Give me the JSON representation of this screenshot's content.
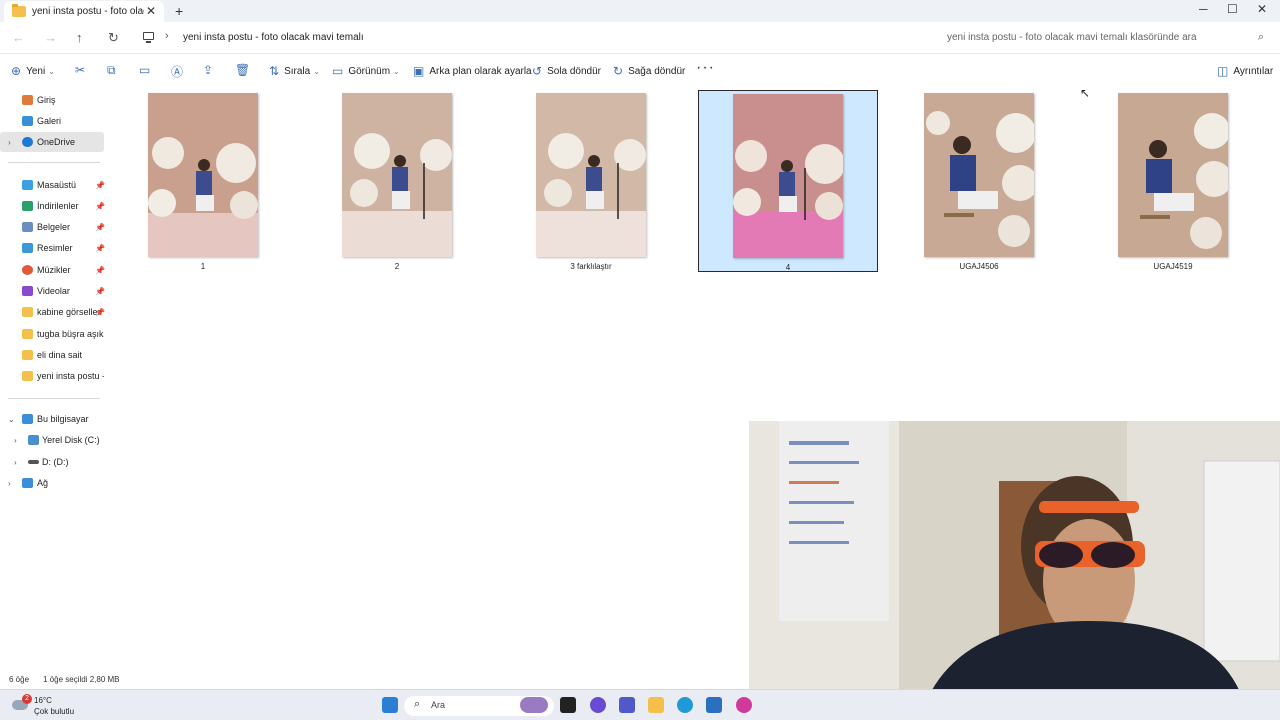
{
  "tab": {
    "title": "yeni insta postu -  foto olacak",
    "close": "✕",
    "add": "+"
  },
  "window": {
    "minimize": "─",
    "maximize": "☐",
    "close": "✕"
  },
  "address": {
    "back": "←",
    "forward": "→",
    "up": "↑",
    "refresh": "↻",
    "separator": "›",
    "path": "yeni insta postu -  foto olacak mavi temalı",
    "search_placeholder": "yeni insta postu -  foto olacak mavi temalı klasöründe ara"
  },
  "toolbar": {
    "new_label": "Yeni",
    "sort_label": "Sırala",
    "view_label": "Görünüm",
    "set_background_label": "Arka plan olarak ayarla",
    "rotate_left_label": "Sola döndür",
    "rotate_right_label": "Sağa döndür",
    "more_label": "···",
    "details_label": "Ayrıntılar"
  },
  "sidebar": {
    "top": [
      {
        "label": "Giriş",
        "icon": "home-icon",
        "color": "#e07a3a"
      },
      {
        "label": "Galeri",
        "icon": "gallery-icon",
        "color": "#3a8fd9"
      },
      {
        "label": "OneDrive",
        "icon": "cloud-icon",
        "color": "#1f78d1"
      }
    ],
    "pinned": [
      {
        "label": "Masaüstü",
        "icon": "desktop-icon",
        "color": "#3aa0e0"
      },
      {
        "label": "İndirilenler",
        "icon": "download-icon",
        "color": "#2aa06a"
      },
      {
        "label": "Belgeler",
        "icon": "documents-icon",
        "color": "#6a8fbf"
      },
      {
        "label": "Resimler",
        "icon": "pictures-icon",
        "color": "#3a9ad9"
      },
      {
        "label": "Müzikler",
        "icon": "music-icon",
        "color": "#e05a3a"
      },
      {
        "label": "Videolar",
        "icon": "video-icon",
        "color": "#8a4ad0"
      },
      {
        "label": "kabine görseller",
        "icon": "folder-icon",
        "color": "#f4c04b"
      },
      {
        "label": "tugba büşra aşık dü",
        "icon": "folder-icon",
        "color": "#f4c04b"
      },
      {
        "label": "eli dina sait",
        "icon": "folder-icon",
        "color": "#f4c04b"
      },
      {
        "label": "yeni insta postu -  f",
        "icon": "folder-icon",
        "color": "#f4c04b"
      }
    ],
    "this_pc": {
      "label": "Bu bilgisayar",
      "icon": "computer-icon",
      "color": "#3a8fd9"
    },
    "drives": [
      {
        "label": "Yerel Disk (C:)",
        "icon": "drive-icon",
        "color": "#4a8fd0"
      },
      {
        "label": "D: (D:)",
        "icon": "drive-icon",
        "color": "#555555"
      }
    ],
    "network": {
      "label": "Ağ",
      "icon": "network-icon",
      "color": "#3a8fd9"
    }
  },
  "files": [
    {
      "name": "1",
      "selected": false,
      "tone": "warm"
    },
    {
      "name": "2",
      "selected": false,
      "tone": "light"
    },
    {
      "name": "3 farklılaştır",
      "selected": false,
      "tone": "light"
    },
    {
      "name": "4",
      "selected": true,
      "tone": "pink"
    },
    {
      "name": "UGAJ4506",
      "selected": false,
      "tone": "close"
    },
    {
      "name": "UGAJ4519",
      "selected": false,
      "tone": "close"
    }
  ],
  "status": {
    "count": "6 öğe",
    "selection": "1 öğe seçildi  2,80 MB"
  },
  "taskbar": {
    "weather_temp": "16°C",
    "weather_condition": "Çok bulutlu",
    "weather_badge": "2",
    "search_label": "Ara"
  },
  "colors": {
    "selection_bg": "#cde8ff",
    "accent": "#3b6fb6",
    "taskbar_bg": "#e9ecf2"
  }
}
